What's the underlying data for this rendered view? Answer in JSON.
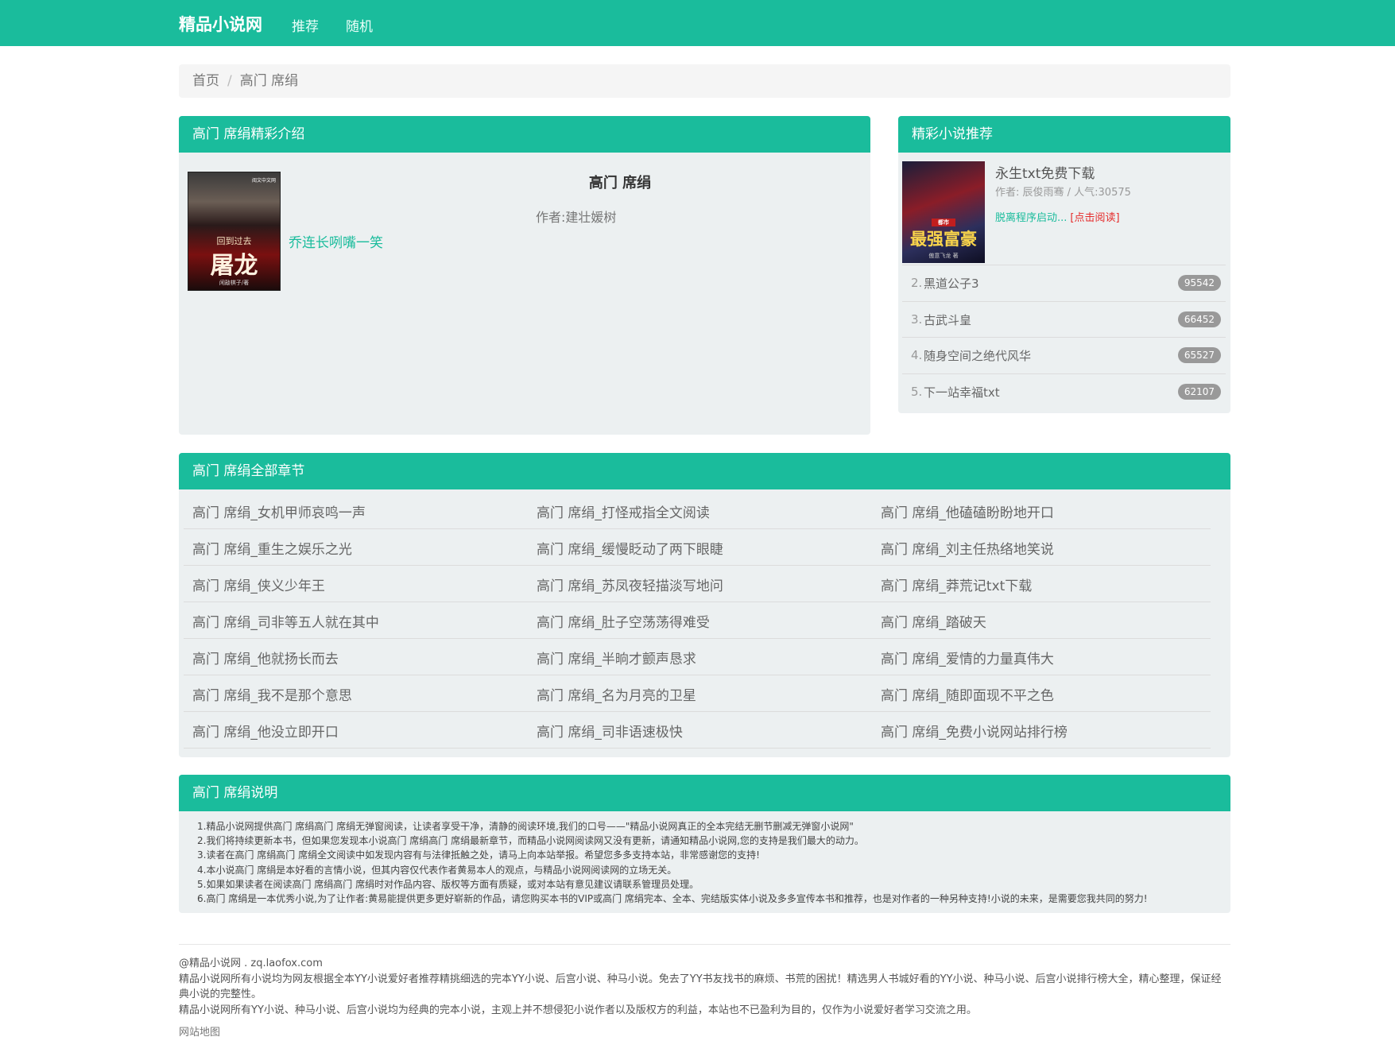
{
  "nav": {
    "brand": "精品小说网",
    "links": [
      "推荐",
      "随机"
    ]
  },
  "breadcrumb": {
    "home": "首页",
    "separator": "/",
    "current": "高门 席绢"
  },
  "intro": {
    "header": "高门 席绢精彩介绍",
    "title": "高门 席绢",
    "author": "作者:建壮媛树",
    "description": "乔连长咧嘴一笑",
    "cover": {
      "line1": "回到过去",
      "line2": "屠龙",
      "line3": "闲敲棋子/著",
      "badge": "阅文中文网"
    }
  },
  "recommend": {
    "header": "精彩小说推荐",
    "top": {
      "title": "永生txt免费下载",
      "meta": "作者: 辰俊雨骞 / 人气:30575",
      "snippet": "脱离程序启动...",
      "read_label": "[点击阅读]",
      "cover": {
        "tag": "都市",
        "title": "最强富豪",
        "sub": "傲意飞龙 著"
      }
    },
    "list": [
      {
        "rank": "2.",
        "name": "黑道公子3",
        "count": "95542"
      },
      {
        "rank": "3.",
        "name": "古武斗皇",
        "count": "66452"
      },
      {
        "rank": "4.",
        "name": "随身空间之绝代风华",
        "count": "65527"
      },
      {
        "rank": "5.",
        "name": "下一站幸福txt",
        "count": "62107"
      }
    ]
  },
  "chapters": {
    "header": "高门 席绢全部章节",
    "rows": [
      [
        "高门 席绢_女机甲师哀鸣一声",
        "高门 席绢_打怪戒指全文阅读",
        "高门 席绢_他磕磕盼盼地开口"
      ],
      [
        "高门 席绢_重生之娱乐之光",
        "高门 席绢_缓慢眨动了两下眼睫",
        "高门 席绢_刘主任热络地笑说"
      ],
      [
        "高门 席绢_侠义少年王",
        "高门 席绢_苏凤夜轻描淡写地问",
        "高门 席绢_莽荒记txt下载"
      ],
      [
        "高门 席绢_司非等五人就在其中",
        "高门 席绢_肚子空荡荡得难受",
        "高门 席绢_踏破天"
      ],
      [
        "高门 席绢_他就扬长而去",
        "高门 席绢_半晌才颤声恳求",
        "高门 席绢_爱情的力量真伟大"
      ],
      [
        "高门 席绢_我不是那个意思",
        "高门 席绢_名为月亮的卫星",
        "高门 席绢_随即面现不平之色"
      ],
      [
        "高门 席绢_他没立即开口",
        "高门 席绢_司非语速极快",
        "高门 席绢_免费小说网站排行榜"
      ]
    ]
  },
  "notes": {
    "header": "高门 席绢说明",
    "lines": [
      "1.精品小说网提供高门 席绢高门 席绢无弹窗阅读，让读者享受干净，清静的阅读环境,我们的口号——\"精品小说网真正的全本完结无删节删减无弹窗小说网\"",
      "2.我们将持续更新本书，但如果您发现本小说高门 席绢高门 席绢最新章节，而精品小说网阅读网又没有更新，请通知精品小说网,您的支持是我们最大的动力。",
      "3.读者在高门 席绢高门 席绢全文阅读中如发现内容有与法律抵触之处，请马上向本站举报。希望您多多支持本站，非常感谢您的支持!",
      "4.本小说高门 席绢是本好看的言情小说，但其内容仅代表作者黄易本人的观点，与精品小说网阅读网的立场无关。",
      "5.如果如果读者在阅读高门 席绢高门 席绢时对作品内容、版权等方面有质疑，或对本站有意见建议请联系管理员处理。",
      "6.高门 席绢是一本优秀小说,为了让作者:黄易能提供更多更好崭新的作品，请您购买本书的VIP或高门 席绢完本、全本、完结版实体小说及多多宣传本书和推荐，也是对作者的一种另种支持!小说的未来，是需要您我共同的努力!"
    ]
  },
  "footer": {
    "line1": "@精品小说网 . zq.laofox.com",
    "line2": "精品小说网所有小说均为网友根据全本YY小说爱好者推荐精挑细选的完本YY小说、后宫小说、种马小说。免去了YY书友找书的麻烦、书荒的困扰！精选男人书城好看的YY小说、种马小说、后宫小说排行榜大全，精心整理，保证经典小说的完整性。",
    "line3": "精品小说网所有YY小说、种马小说、后宫小说均为经典的完本小说，主观上并不想侵犯小说作者以及版权方的利益，本站也不已盈利为目的，仅作为小说爱好者学习交流之用。",
    "sitemap": "网站地图"
  },
  "colors": {
    "accent": "#1abc9c",
    "panel_bg": "#ecf0f1",
    "badge": "#999999",
    "read_link": "#e52b2b"
  }
}
